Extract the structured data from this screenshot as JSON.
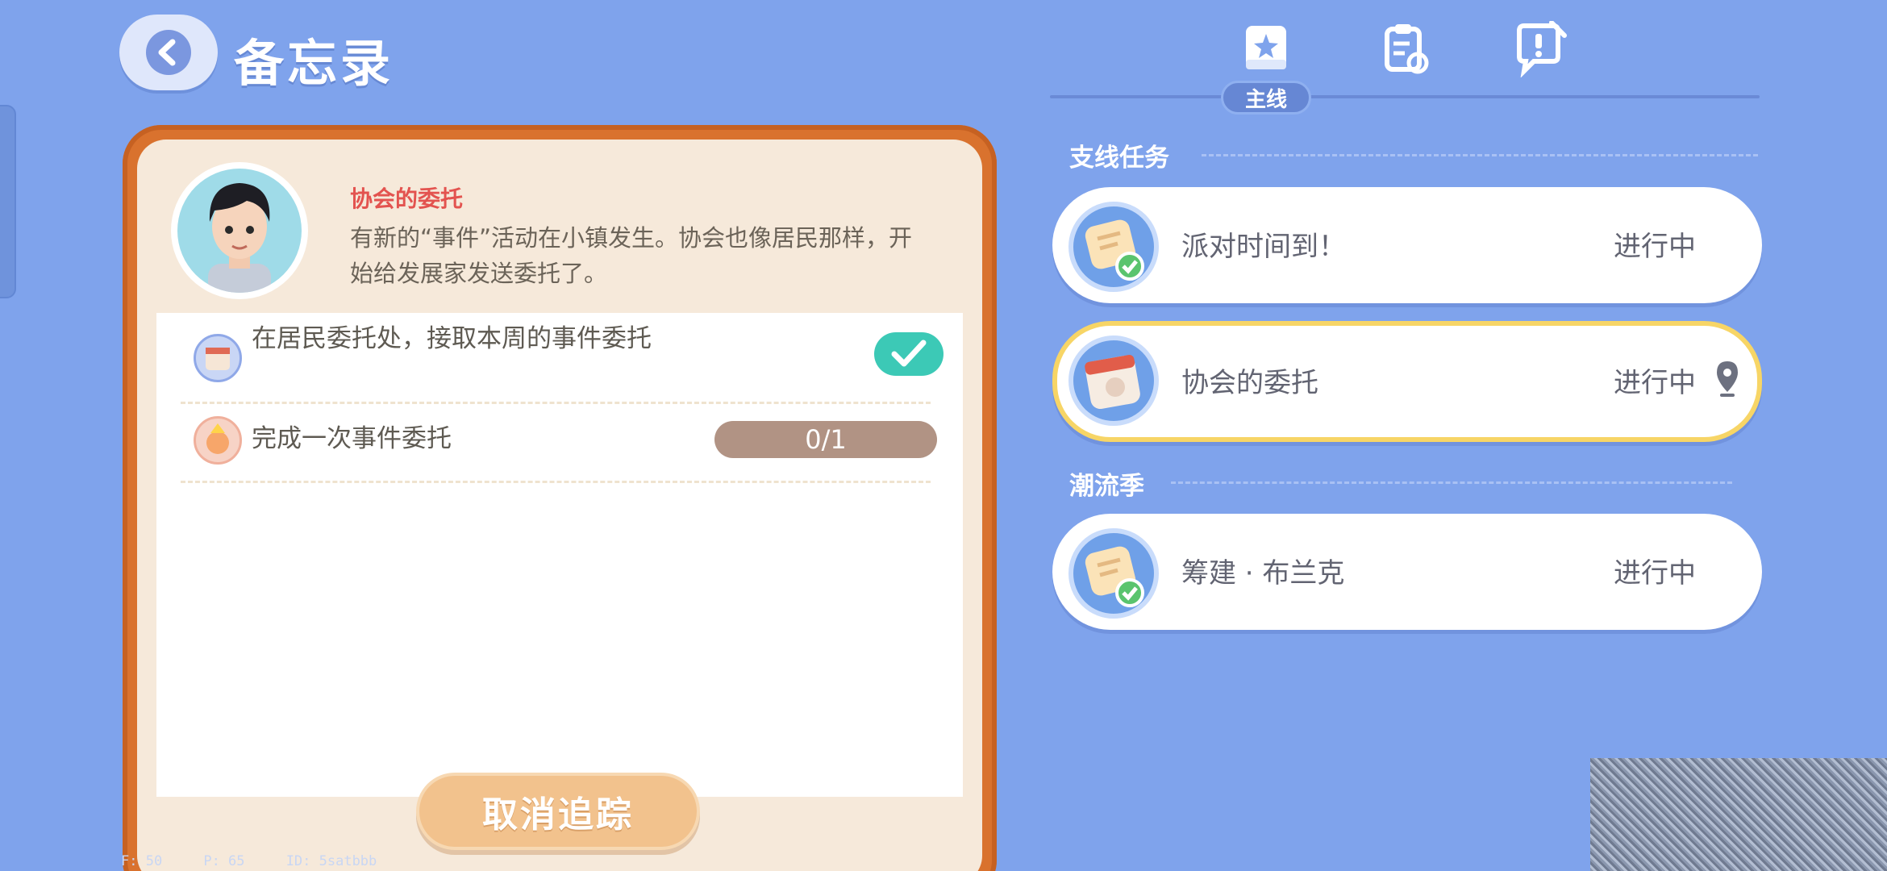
{
  "header": {
    "title": "备忘录"
  },
  "tabs": {
    "active_label": "主线",
    "items": [
      "main-quest",
      "side-clipboard",
      "help"
    ]
  },
  "detail": {
    "quest_title": "协会的委托",
    "description": "有新的“事件”活动在小镇发生。协会也像居民那样，开始给发展家发送委托了。",
    "tasks": [
      {
        "text": "在居民委托处，接取本周的事件委托",
        "status": "completed"
      },
      {
        "text": "完成一次事件委托",
        "progress_text": "0/1",
        "progress": 0
      }
    ],
    "untrack_label": "取消追踪"
  },
  "sections": [
    {
      "heading": "支线任务",
      "quests": [
        {
          "name": "派对时间到！",
          "status": "进行中",
          "icon": "note-check-icon",
          "active": false
        },
        {
          "name": "协会的委托",
          "status": "进行中",
          "icon": "calendar-icon",
          "active": true
        }
      ]
    },
    {
      "heading": "潮流季",
      "quests": [
        {
          "name": "筹建 · 布兰克",
          "status": "进行中",
          "icon": "note-check-icon",
          "active": false
        }
      ]
    }
  ],
  "debug": "F: 50     P: 65     ID: 5satbbb",
  "colors": {
    "background": "#7fa3ec",
    "frame": "#d9722e",
    "accent_red": "#e3534f",
    "check_green": "#3cc9b6",
    "active_border": "#f7d566"
  }
}
